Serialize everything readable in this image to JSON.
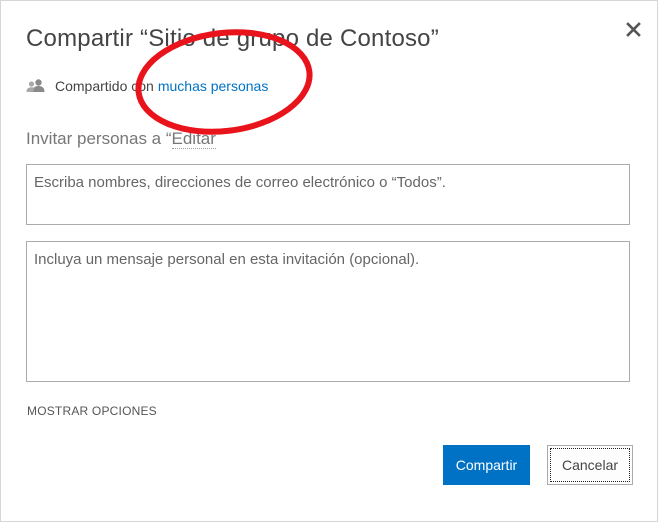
{
  "dialog": {
    "title": "Compartir “Sitio de grupo de Contoso”",
    "close_icon": "close-icon",
    "shared": {
      "prefix": "Compartido con",
      "link": "muchas personas",
      "icon": "people-icon"
    },
    "invite_label_prefix": "Invitar personas a “",
    "invite_label_edit": "Editar",
    "names_placeholder": "Escriba nombres, direcciones de correo electrónico o “Todos”.",
    "message_placeholder": "Incluya un mensaje personal en esta invitación (opcional).",
    "show_options": "MOSTRAR OPCIONES",
    "share_button": "Compartir",
    "cancel_button": "Cancelar"
  },
  "colors": {
    "accent": "#0072c6",
    "annotation": "#e8131b"
  }
}
